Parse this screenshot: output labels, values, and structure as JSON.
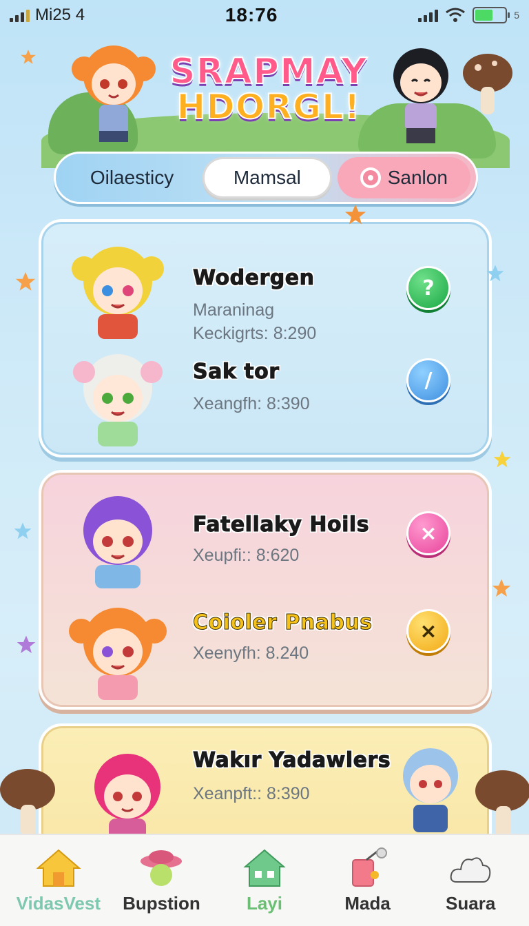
{
  "status_bar": {
    "carrier": "Mi25 4",
    "time": "18:76",
    "battery_suffix": "5"
  },
  "header": {
    "title_line1": "SRAPMAY",
    "title_line2": "HDORGL!"
  },
  "tabs": {
    "tab1": "Oilaesticy",
    "tab2": "Mamsal",
    "tab3": "Sanlon",
    "selected": "Mamsal"
  },
  "cards": [
    {
      "theme": "blue",
      "rows": [
        {
          "name": "Wodergen",
          "sub1": "Maraninag",
          "sub2": "Keckigrts: 8:290",
          "action_icon": "question-icon",
          "action_glyph": "?"
        },
        {
          "name": "Sak tor",
          "sub1": "Xeangfh: 8:390",
          "action_icon": "slash-icon",
          "action_glyph": "/"
        }
      ]
    },
    {
      "theme": "pink",
      "rows": [
        {
          "name": "Fatellaky Hoils",
          "sub1": "Xeupfi:: 8:620",
          "action_icon": "close-icon",
          "action_glyph": "×"
        },
        {
          "name": "Coioler Pnabus",
          "sub1": "Xeenyfh: 8.240",
          "action_icon": "close-icon",
          "action_glyph": "×"
        }
      ]
    },
    {
      "theme": "yellow",
      "rows": [
        {
          "name": "Wakır Yadawlers",
          "sub1": "Xeanpft:: 8:390"
        }
      ]
    }
  ],
  "bottom_nav": {
    "items": [
      {
        "label": "VidasVest",
        "icon": "house-icon",
        "active": true
      },
      {
        "label": "Bupstion",
        "icon": "hat-icon"
      },
      {
        "label": "Layi",
        "icon": "green-house-icon"
      },
      {
        "label": "Mada",
        "icon": "drink-icon"
      },
      {
        "label": "Suara",
        "icon": "cloud-icon"
      }
    ]
  },
  "colors": {
    "background": "#cfeaf8",
    "card_blue": "#d7eef9",
    "card_pink": "#f7d3dd",
    "card_yellow": "#fbeeb6",
    "action_green": "#1aa844",
    "action_blue": "#3f8fe0",
    "action_pink": "#e8439a",
    "action_yellow": "#f2a915"
  }
}
